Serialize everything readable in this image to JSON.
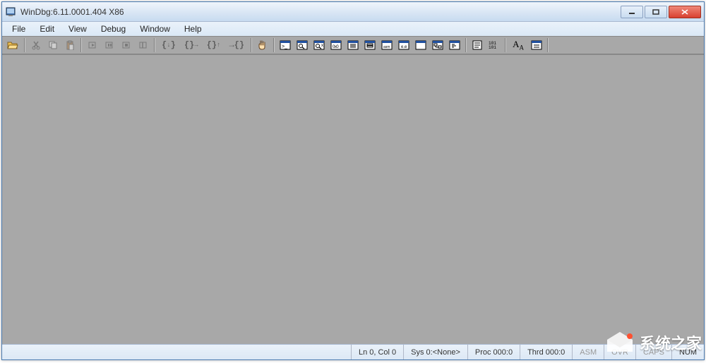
{
  "title": "WinDbg:6.11.0001.404 X86",
  "menu": {
    "file": "File",
    "edit": "Edit",
    "view": "View",
    "debug": "Debug",
    "window": "Window",
    "help": "Help"
  },
  "toolbar": {
    "open": "open-folder",
    "cut": "cut",
    "copy": "copy",
    "paste": "paste",
    "go": "go",
    "restart": "restart",
    "stop": "stop-debugging",
    "break": "break",
    "step_into": "step-into",
    "step_over": "step-over",
    "step_out": "step-out",
    "run_to_cursor": "run-to-cursor",
    "bp_toggle": "toggle-breakpoint",
    "src_mode": "source-mode",
    "font": "font",
    "options": "options"
  },
  "status": {
    "ln_col": "Ln 0, Col 0",
    "sys": "Sys 0:<None>",
    "proc": "Proc 000:0",
    "thrd": "Thrd 000:0",
    "asm": "ASM",
    "ovr": "OVR",
    "caps": "CAPS",
    "num": "NUM"
  },
  "watermark": "系统之家"
}
